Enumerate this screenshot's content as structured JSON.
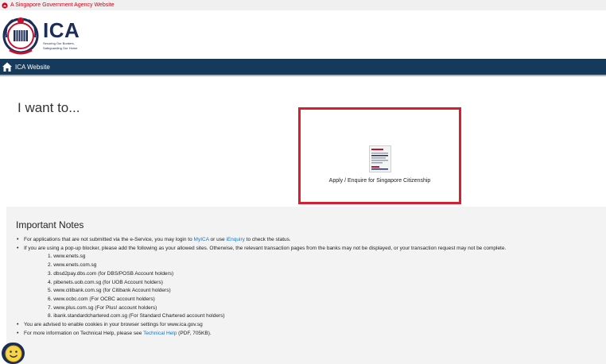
{
  "gov_bar": {
    "text": "A Singapore Government Agency Website"
  },
  "logo": {
    "title": "ICA",
    "tagline_1": "Securing Our Borders,",
    "tagline_2": "Safeguarding Our Home"
  },
  "nav": {
    "home_icon": "home-icon",
    "link": "ICA Website"
  },
  "main": {
    "heading": "I want to...",
    "card": {
      "icon": "document-icon",
      "label": "Apply / Enquire for Singapore Citizenship",
      "border_color": "#d7202f"
    }
  },
  "notes": {
    "title": "Important Notes",
    "item1": {
      "pre": "For applications that are not submitted via the e-Service, you may login to ",
      "link1": "MyICA",
      "mid": " or use ",
      "link2": "iEnquiry",
      "post": " to check the status."
    },
    "item2": {
      "text": "If you are using a pop-up blocker, please add the following as your allowed sites. Otherwise, the relevant transaction pages from the banks may not be displayed, or your transaction request may not be complete."
    },
    "sites": [
      "1. www.enets.sg",
      "2. www.enets.com.sg",
      "3. dbsd2pay.dbs.com (for DBS/POSB Account holders)",
      "4. pibenets.uob.com.sg (for UOB Account holders)",
      "5. www.citibank.com.sg (for Citibank Account holders)",
      "6. www.ocbc.com (For OCBC account holders)",
      "7. www.plus.com.sg (For Plus! account holders)",
      "8. ibank.standardchartered.com.sg (For Standard Chartered account holders)"
    ],
    "item3": {
      "text": "You are advised to enable cookies in your browser settings for www.ica.gov.sg"
    },
    "item4": {
      "pre": "For more information on Technical Help, please see ",
      "link": "Technical Help",
      "post": " (PDF, 705KB)."
    }
  },
  "chat": {
    "icon": "smiley-chat-icon"
  },
  "colors": {
    "nav_bg": "#153a5b",
    "accent_red": "#d7202f",
    "link": "#1a73c4",
    "brand_navy": "#1c2d5a"
  }
}
